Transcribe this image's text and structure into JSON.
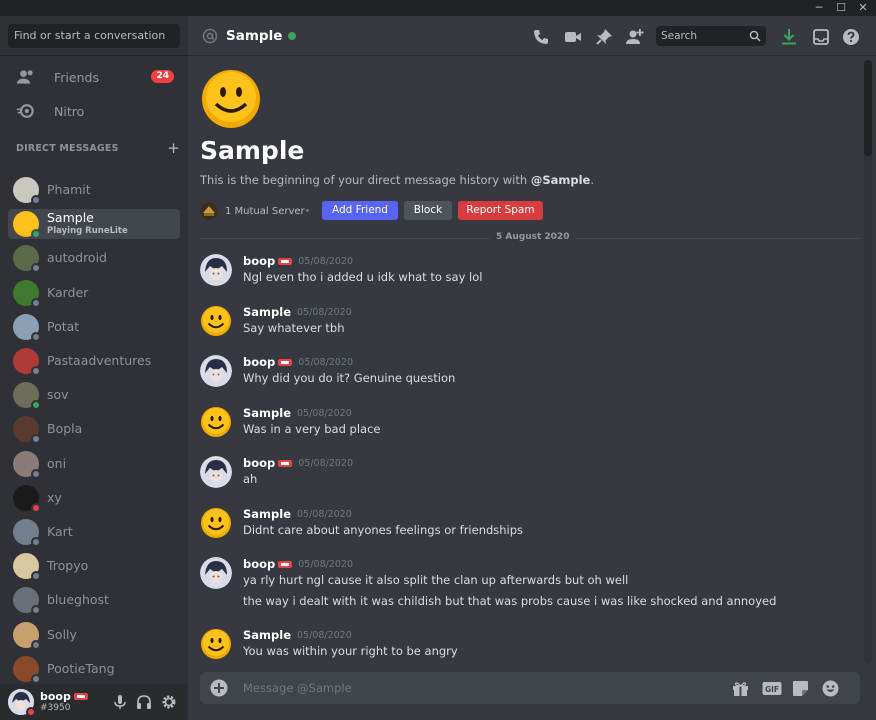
{
  "window": {
    "minimize": "─",
    "maximize": "☐",
    "close": "✕"
  },
  "sidebar": {
    "search_placeholder": "Find or start a conversation",
    "nav": [
      {
        "label": "Friends",
        "icon": "friends-icon",
        "badge": "24"
      },
      {
        "label": "Nitro",
        "icon": "nitro-icon"
      }
    ],
    "dm_header": "DIRECT MESSAGES",
    "dm_add": "+",
    "dms": [
      {
        "name": "Phamit",
        "status": "offline",
        "color": "#c9c7c0"
      },
      {
        "name": "Sample",
        "status": "online",
        "activity": "Playing RuneLite",
        "active": true,
        "color": "#e8a317"
      },
      {
        "name": "autodroid",
        "status": "offline",
        "color": "#5b6b4a"
      },
      {
        "name": "Karder",
        "status": "offline",
        "color": "#3d7a2e"
      },
      {
        "name": "Potat",
        "status": "offline",
        "color": "#8aa0b4"
      },
      {
        "name": "Pastaadventures",
        "status": "offline",
        "color": "#b03a3a"
      },
      {
        "name": "sov",
        "status": "online",
        "color": "#6d6d5a"
      },
      {
        "name": "Bopla",
        "status": "offline",
        "color": "#5a3a2e"
      },
      {
        "name": "oni",
        "status": "offline",
        "color": "#8a7a7a"
      },
      {
        "name": "xy",
        "status": "dnd",
        "color": "#1a1a1a"
      },
      {
        "name": "Kart",
        "status": "offline",
        "color": "#747f8d"
      },
      {
        "name": "Tropyo",
        "status": "offline",
        "color": "#d8c8a0"
      },
      {
        "name": "blueghost",
        "status": "offline",
        "color": "#6a6f78"
      },
      {
        "name": "Solly",
        "status": "offline",
        "color": "#c8a070"
      },
      {
        "name": "PootieTang",
        "status": "offline",
        "color": "#8a4a2a"
      }
    ],
    "user": {
      "name": "boop",
      "tag": "#3950"
    }
  },
  "header": {
    "title": "Sample",
    "search_placeholder": "Search"
  },
  "welcome": {
    "title": "Sample",
    "text_prefix": "This is the beginning of your direct message history with ",
    "mention": "@Sample",
    "text_suffix": ".",
    "mutual": "1 Mutual Server",
    "add_friend": "Add Friend",
    "block": "Block",
    "report": "Report Spam"
  },
  "date_divider": "5 August 2020",
  "messages": [
    {
      "author": "boop",
      "time": "05/08/2020",
      "lines": [
        "Ngl even tho i added u idk what to say lol"
      ]
    },
    {
      "author": "Sample",
      "time": "05/08/2020",
      "lines": [
        "Say whatever tbh"
      ]
    },
    {
      "author": "boop",
      "time": "05/08/2020",
      "lines": [
        "Why did you do it? Genuine question"
      ]
    },
    {
      "author": "Sample",
      "time": "05/08/2020",
      "lines": [
        "Was in a very bad place"
      ]
    },
    {
      "author": "boop",
      "time": "05/08/2020",
      "lines": [
        "ah"
      ]
    },
    {
      "author": "Sample",
      "time": "05/08/2020",
      "lines": [
        "Didnt care about anyones feelings or friendships"
      ]
    },
    {
      "author": "boop",
      "time": "05/08/2020",
      "lines": [
        "ya rly hurt ngl cause it also split the clan up afterwards but oh well",
        "the way i dealt with it was childish but that was probs cause i was like shocked and annoyed"
      ]
    },
    {
      "author": "Sample",
      "time": "05/08/2020",
      "lines": [
        "You was within your right to be angry"
      ]
    }
  ],
  "composer": {
    "placeholder": "Message @Sample"
  },
  "colors": {
    "blurple": "#5865f2",
    "red": "#d83c3e",
    "gray": "#4f545c",
    "online": "#3ba55d"
  }
}
